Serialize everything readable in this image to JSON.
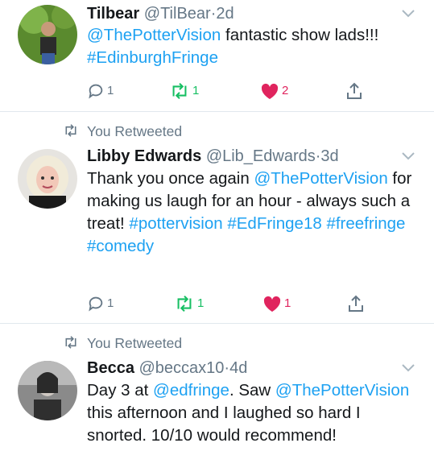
{
  "tweets": [
    {
      "name": "Tilbear",
      "handle": "@TilBear",
      "dot": "·",
      "time": "2d",
      "retweeted_label": "",
      "body_segments": [
        {
          "text": "@ThePotterVision",
          "link": true
        },
        {
          "text": " fantastic show lads!!! ",
          "link": false
        },
        {
          "text": "#EdinburghFringe",
          "link": true
        }
      ],
      "replies": "1",
      "retweets": "1",
      "likes": "2",
      "liked": true
    },
    {
      "name": "Libby Edwards",
      "handle": "@Lib_Edwards",
      "dot": "·",
      "time": "3d",
      "retweeted_label": "You Retweeted",
      "body_segments": [
        {
          "text": "Thank you once again ",
          "link": false
        },
        {
          "text": "@ThePotterVision",
          "link": true
        },
        {
          "text": " for making us laugh for an hour - always such a treat! ",
          "link": false
        },
        {
          "text": "#pottervision",
          "link": true
        },
        {
          "text": " ",
          "link": false
        },
        {
          "text": "#EdFringe18",
          "link": true
        },
        {
          "text": " ",
          "link": false
        },
        {
          "text": "#freefringe",
          "link": true
        },
        {
          "text": " ",
          "link": false
        },
        {
          "text": "#comedy",
          "link": true
        }
      ],
      "replies": "1",
      "retweets": "1",
      "likes": "1",
      "liked": true
    },
    {
      "name": "Becca",
      "handle": "@beccax10",
      "dot": "·",
      "time": "4d",
      "retweeted_label": "You Retweeted",
      "body_segments": [
        {
          "text": "Day 3 at ",
          "link": false
        },
        {
          "text": "@edfringe",
          "link": true
        },
        {
          "text": ". Saw ",
          "link": false
        },
        {
          "text": "@ThePotterVision",
          "link": true
        },
        {
          "text": " this afternoon and I laughed so hard I snorted. 10/10 would recommend!",
          "link": false
        }
      ]
    }
  ],
  "colors": {
    "link": "#1da1f2",
    "retweet_green": "#17bf63",
    "like_red": "#e0245e",
    "muted": "#657786",
    "divider": "#e1e8ed"
  },
  "icons": [
    "reply-icon",
    "retweet-icon",
    "heart-icon",
    "share-icon",
    "chevron-down-icon"
  ]
}
